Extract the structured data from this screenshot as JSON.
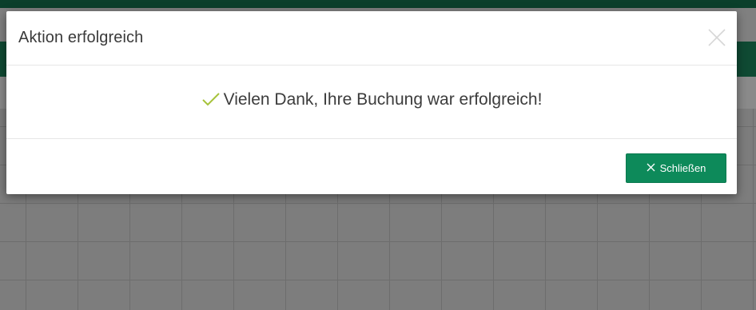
{
  "modal": {
    "title": "Aktion erfolgreich",
    "message": "Vielen Dank, Ihre Buchung war erfolgreich!",
    "close_button_label": "Schließen"
  },
  "icons": {
    "success": "check-icon",
    "dismiss": "close-icon",
    "button": "x-icon"
  },
  "colors": {
    "primary_button": "#0d8a5a",
    "success_check": "#a6c23a",
    "header_background": "#0f4a33"
  }
}
